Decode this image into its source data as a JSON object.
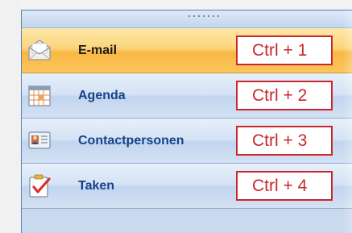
{
  "nav": {
    "items": [
      {
        "label": "E-mail",
        "shortcut": "Ctrl + 1",
        "icon": "mail-envelope-icon",
        "active": true
      },
      {
        "label": "Agenda",
        "shortcut": "Ctrl + 2",
        "icon": "calendar-icon",
        "active": false
      },
      {
        "label": "Contactpersonen",
        "shortcut": "Ctrl + 3",
        "icon": "contact-card-icon",
        "active": false
      },
      {
        "label": "Taken",
        "shortcut": "Ctrl + 4",
        "icon": "task-clipboard-icon",
        "active": false
      }
    ]
  },
  "colors": {
    "active_background": "#f9b743",
    "item_background": "#d4e2f4",
    "label_blue": "#15428b",
    "shortcut_red": "#c8272d"
  }
}
